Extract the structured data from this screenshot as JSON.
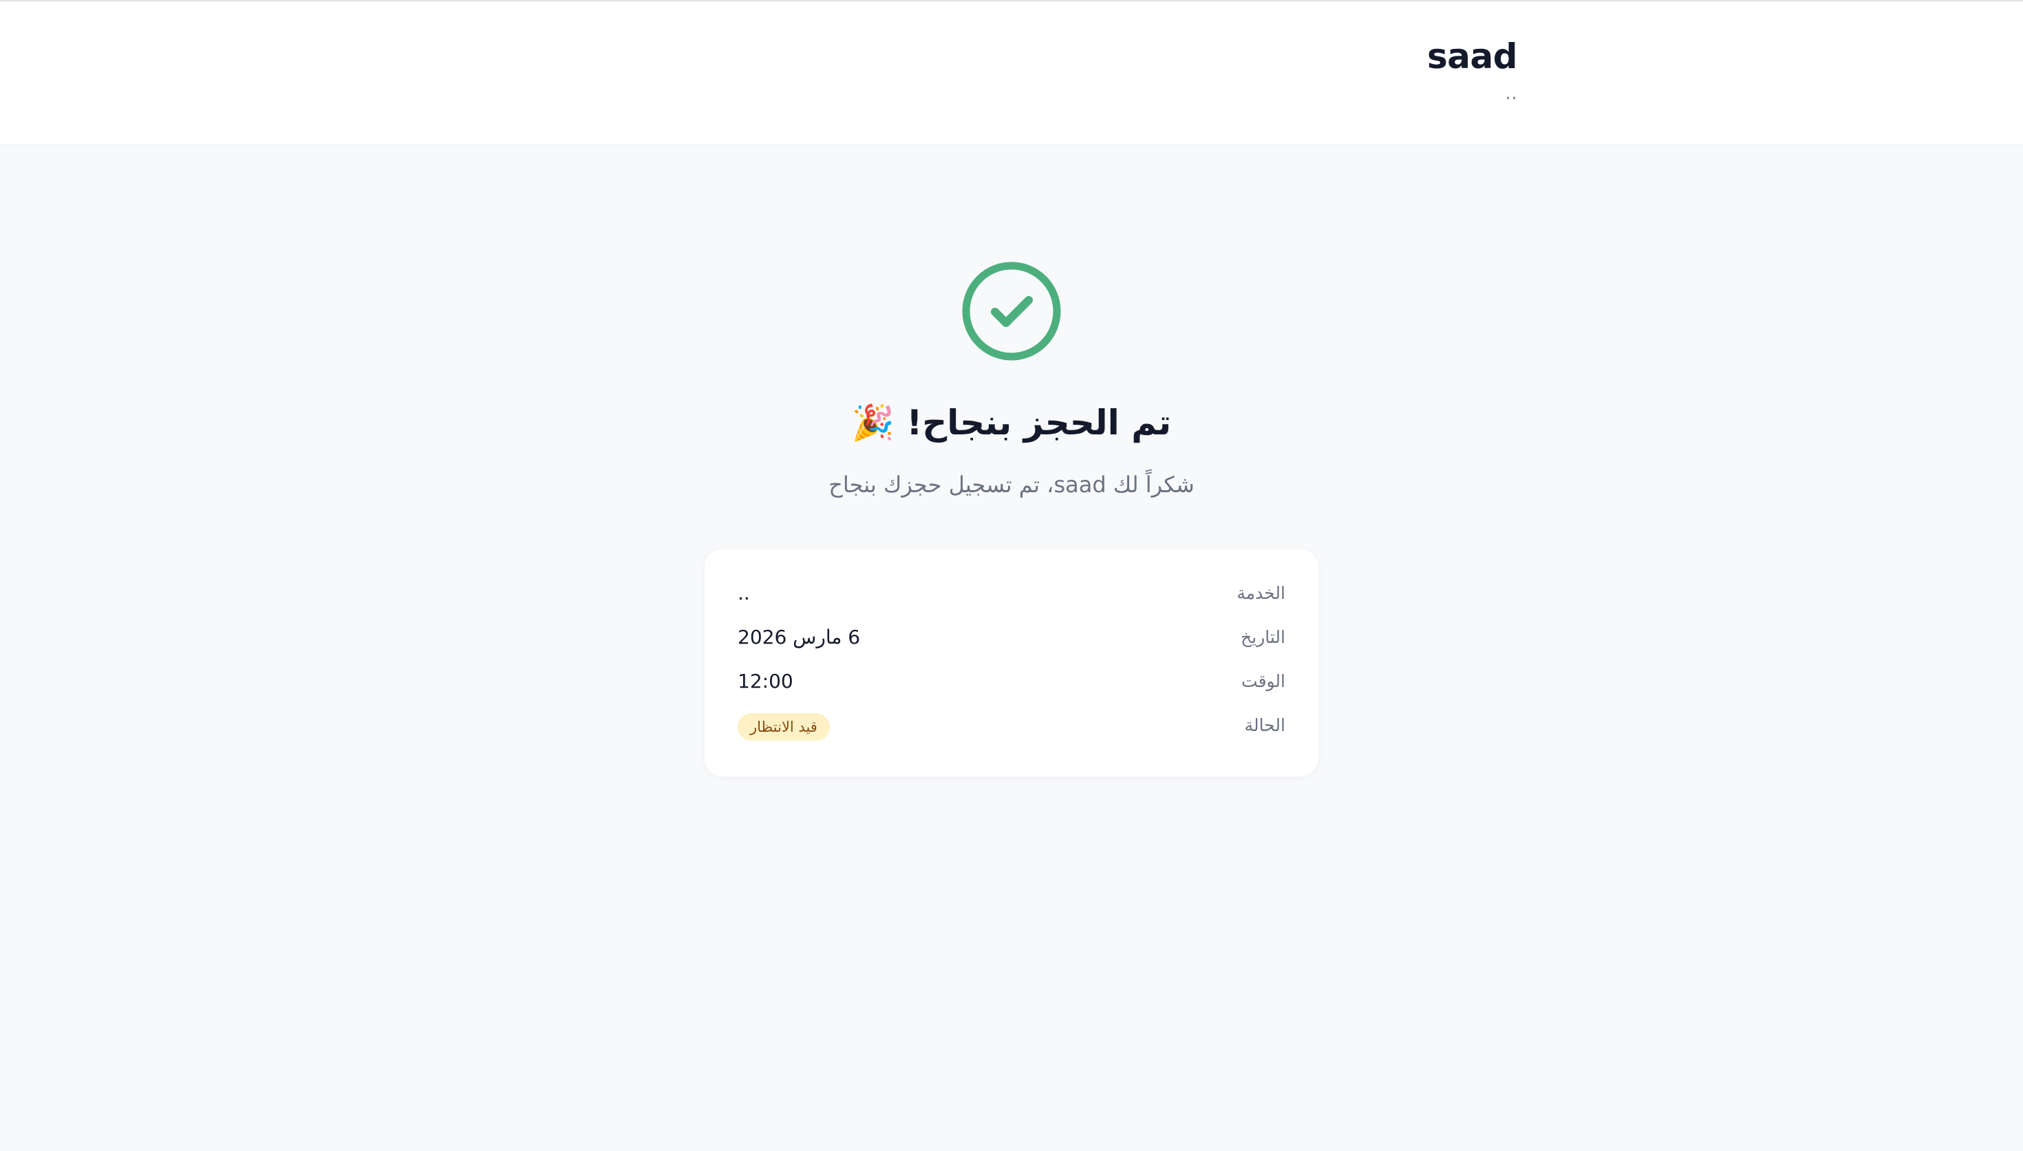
{
  "header": {
    "business_name": "saad",
    "business_subtitle": ".."
  },
  "confirmation": {
    "icon": "check-circle-icon",
    "accent_color": "#4caf7d",
    "title": "تم الحجز بنجاح! 🎉",
    "message": "شكراً لك saad، تم تسجيل حجزك بنجاح"
  },
  "details": {
    "rows": [
      {
        "label": "الخدمة",
        "value": ".."
      },
      {
        "label": "التاريخ",
        "value": "6 مارس 2026"
      },
      {
        "label": "الوقت",
        "value": "12:00"
      },
      {
        "label": "الحالة",
        "value": "قيد الانتظار"
      }
    ],
    "status_badge_color": "#fdf1c5"
  }
}
